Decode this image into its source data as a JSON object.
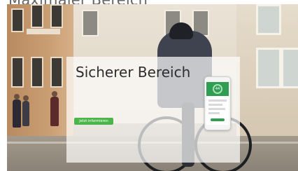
{
  "page": {
    "top_heading": "Maximaler Bereich"
  },
  "panel": {
    "title": "Sicherer Bereich",
    "cta_label": "Jetzt informieren"
  },
  "phone": {
    "score": "44"
  },
  "colors": {
    "accent_green": "#4bb54a",
    "app_green": "#2f9e53"
  }
}
